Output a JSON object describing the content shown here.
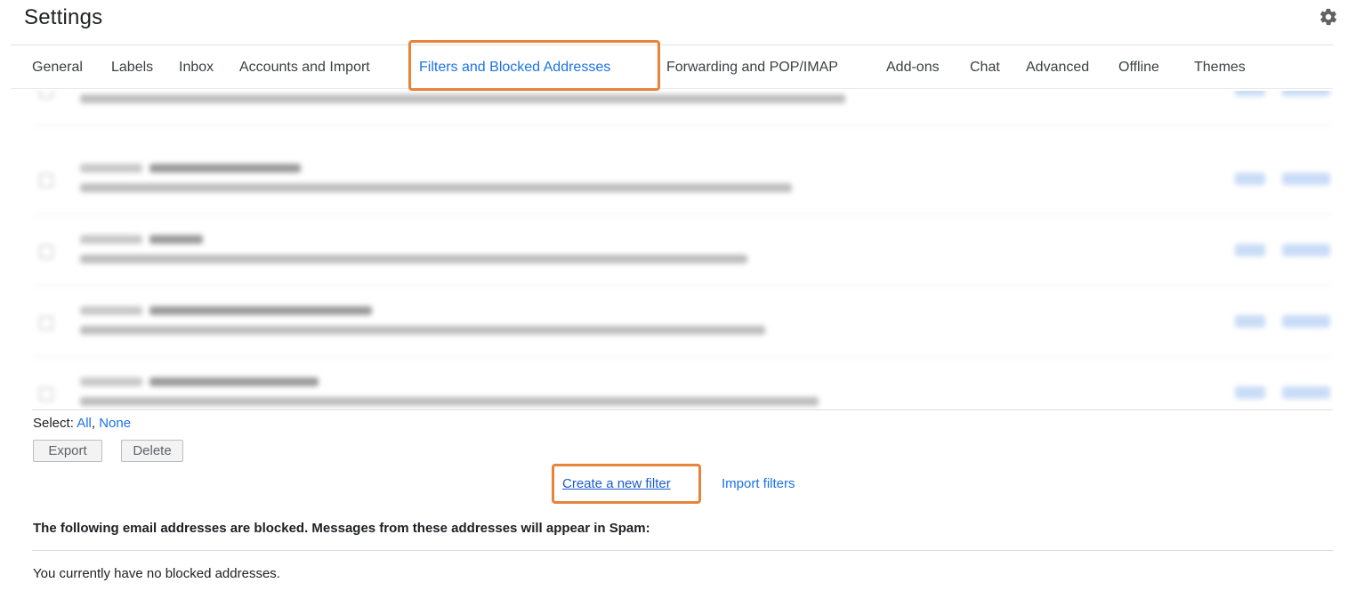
{
  "header": {
    "title": "Settings",
    "gear_icon": "gear-icon"
  },
  "tabs": [
    {
      "label": "General"
    },
    {
      "label": "Labels"
    },
    {
      "label": "Inbox"
    },
    {
      "label": "Accounts and Import"
    },
    {
      "label": "Filters and Blocked Addresses",
      "active": true
    },
    {
      "label": "Forwarding and POP/IMAP"
    },
    {
      "label": "Add-ons"
    },
    {
      "label": "Chat"
    },
    {
      "label": "Advanced"
    },
    {
      "label": "Offline"
    },
    {
      "label": "Themes"
    }
  ],
  "filters": {
    "rows_blurred": true
  },
  "selection": {
    "prefix": "Select:",
    "all": "All",
    "separator": ",",
    "none": "None"
  },
  "actions": {
    "export": "Export",
    "delete": "Delete",
    "create_filter": "Create a new filter",
    "import_filters": "Import filters"
  },
  "blocked": {
    "heading": "The following email addresses are blocked. Messages from these addresses will appear in Spam:",
    "empty": "You currently have no blocked addresses."
  },
  "colors": {
    "accent": "#1a73e8",
    "highlight": "#e8833a",
    "text": "#202124"
  }
}
